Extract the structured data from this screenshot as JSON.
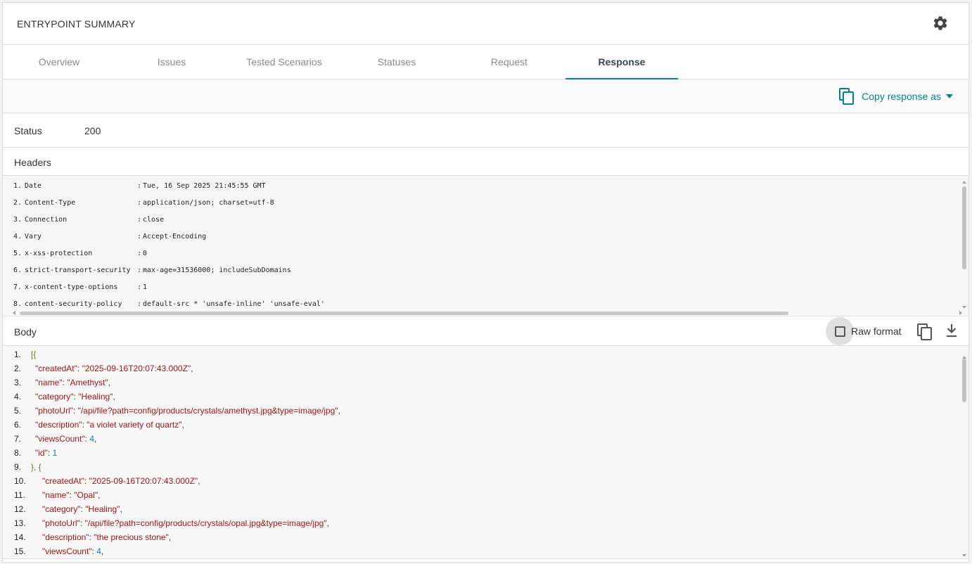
{
  "header": {
    "title": "ENTRYPOINT SUMMARY",
    "settings_icon": "gear-icon"
  },
  "tabs": [
    {
      "label": "Overview",
      "active": false
    },
    {
      "label": "Issues",
      "active": false
    },
    {
      "label": "Tested Scenarios",
      "active": false
    },
    {
      "label": "Statuses",
      "active": false
    },
    {
      "label": "Request",
      "active": false
    },
    {
      "label": "Response",
      "active": true
    }
  ],
  "toolbar": {
    "copy_label": "Copy response as",
    "copy_icon": "copy-icon"
  },
  "status": {
    "label": "Status",
    "value": "200"
  },
  "headers_section": {
    "label": "Headers",
    "rows": [
      {
        "n": "1.",
        "k": "Date",
        "v": "Tue, 16 Sep 2025 21:45:55 GMT"
      },
      {
        "n": "2.",
        "k": "Content-Type",
        "v": "application/json; charset=utf-8"
      },
      {
        "n": "3.",
        "k": "Connection",
        "v": "close"
      },
      {
        "n": "4.",
        "k": "Vary",
        "v": "Accept-Encoding"
      },
      {
        "n": "5.",
        "k": "x-xss-protection",
        "v": "0"
      },
      {
        "n": "6.",
        "k": "strict-transport-security",
        "v": "max-age=31536000; includeSubDomains"
      },
      {
        "n": "7.",
        "k": "x-content-type-options",
        "v": "1"
      },
      {
        "n": "8.",
        "k": "content-security-policy",
        "v": "default-src * 'unsafe-inline' 'unsafe-eval'"
      }
    ],
    "separator": ":"
  },
  "body_section": {
    "label": "Body",
    "raw_label": "Raw format",
    "raw_checked": false,
    "lines": [
      {
        "n": "1.",
        "indent": 0,
        "parts": [
          {
            "t": "[{",
            "c": "punc"
          }
        ]
      },
      {
        "n": "2.",
        "indent": 1,
        "parts": [
          {
            "t": "\"createdAt\"",
            "c": "key"
          },
          {
            "t": ": ",
            "c": "plain"
          },
          {
            "t": "\"2025-09-16T20:07:43.000Z\"",
            "c": "str"
          },
          {
            "t": ",",
            "c": "plain"
          }
        ]
      },
      {
        "n": "3.",
        "indent": 1,
        "parts": [
          {
            "t": "\"name\"",
            "c": "key"
          },
          {
            "t": ": ",
            "c": "plain"
          },
          {
            "t": "\"Amethyst\"",
            "c": "str"
          },
          {
            "t": ",",
            "c": "plain"
          }
        ]
      },
      {
        "n": "4.",
        "indent": 1,
        "parts": [
          {
            "t": "\"category\"",
            "c": "key"
          },
          {
            "t": ": ",
            "c": "plain"
          },
          {
            "t": "\"Healing\"",
            "c": "str"
          },
          {
            "t": ",",
            "c": "plain"
          }
        ]
      },
      {
        "n": "5.",
        "indent": 1,
        "parts": [
          {
            "t": "\"photoUrl\"",
            "c": "key"
          },
          {
            "t": ": ",
            "c": "plain"
          },
          {
            "t": "\"/api/file?path=config/products/crystals/amethyst.jpg&type=image/jpg\"",
            "c": "str"
          },
          {
            "t": ",",
            "c": "plain"
          }
        ]
      },
      {
        "n": "6.",
        "indent": 1,
        "parts": [
          {
            "t": "\"description\"",
            "c": "key"
          },
          {
            "t": ": ",
            "c": "plain"
          },
          {
            "t": "\"a violet variety of quartz\"",
            "c": "str"
          },
          {
            "t": ",",
            "c": "plain"
          }
        ]
      },
      {
        "n": "7.",
        "indent": 1,
        "parts": [
          {
            "t": "\"viewsCount\"",
            "c": "key"
          },
          {
            "t": ": ",
            "c": "plain"
          },
          {
            "t": "4",
            "c": "num"
          },
          {
            "t": ",",
            "c": "plain"
          }
        ]
      },
      {
        "n": "8.",
        "indent": 1,
        "parts": [
          {
            "t": "\"id\"",
            "c": "key"
          },
          {
            "t": ": ",
            "c": "plain"
          },
          {
            "t": "1",
            "c": "num"
          }
        ]
      },
      {
        "n": "9.",
        "indent": 0,
        "parts": [
          {
            "t": "}, {",
            "c": "punc"
          }
        ]
      },
      {
        "n": "10.",
        "indent": 1,
        "parts": [
          {
            "t": "\"createdAt\"",
            "c": "key"
          },
          {
            "t": ": ",
            "c": "plain"
          },
          {
            "t": "\"2025-09-16T20:07:43.000Z\"",
            "c": "str"
          },
          {
            "t": ",",
            "c": "plain"
          }
        ]
      },
      {
        "n": "11.",
        "indent": 1,
        "parts": [
          {
            "t": "\"name\"",
            "c": "key"
          },
          {
            "t": ": ",
            "c": "plain"
          },
          {
            "t": "\"Opal\"",
            "c": "str"
          },
          {
            "t": ",",
            "c": "plain"
          }
        ]
      },
      {
        "n": "12.",
        "indent": 1,
        "parts": [
          {
            "t": "\"category\"",
            "c": "key"
          },
          {
            "t": ": ",
            "c": "plain"
          },
          {
            "t": "\"Healing\"",
            "c": "str"
          },
          {
            "t": ",",
            "c": "plain"
          }
        ]
      },
      {
        "n": "13.",
        "indent": 1,
        "parts": [
          {
            "t": "\"photoUrl\"",
            "c": "key"
          },
          {
            "t": ": ",
            "c": "plain"
          },
          {
            "t": "\"/api/file?path=config/products/crystals/opal.jpg&type=image/jpg\"",
            "c": "str"
          },
          {
            "t": ",",
            "c": "plain"
          }
        ]
      },
      {
        "n": "14.",
        "indent": 1,
        "parts": [
          {
            "t": "\"description\"",
            "c": "key"
          },
          {
            "t": ": ",
            "c": "plain"
          },
          {
            "t": "\"the precious stone\"",
            "c": "str"
          },
          {
            "t": ",",
            "c": "plain"
          }
        ]
      },
      {
        "n": "15.",
        "indent": 1,
        "parts": [
          {
            "t": "\"viewsCount\"",
            "c": "key"
          },
          {
            "t": ": ",
            "c": "plain"
          },
          {
            "t": "4",
            "c": "num"
          },
          {
            "t": ",",
            "c": "plain"
          }
        ]
      }
    ]
  },
  "colors": {
    "accent": "#00838f",
    "key": "#a31515",
    "number": "#1976d2",
    "bracket": "#6a7a1e"
  }
}
